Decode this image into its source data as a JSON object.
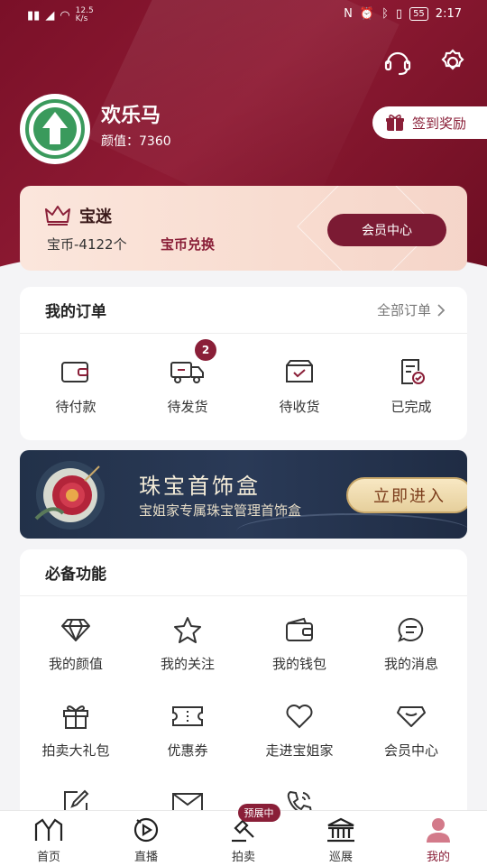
{
  "status_bar": {
    "net_speed": "12.5\nK/s",
    "battery": "55",
    "time": "2:17"
  },
  "profile": {
    "name": "欢乐马",
    "score_label": "颜值：",
    "score_value": "7360"
  },
  "checkin": {
    "label": "签到奖励"
  },
  "member": {
    "level": "宝迷",
    "coins_text": "宝币-4122个",
    "exchange_label": "宝币兑换",
    "center_button": "会员中心"
  },
  "orders": {
    "title": "我的订单",
    "all_label": "全部订单",
    "items": [
      {
        "label": "待付款",
        "icon": "wallet-icon"
      },
      {
        "label": "待发货",
        "icon": "truck-icon",
        "badge": "2"
      },
      {
        "label": "待收货",
        "icon": "box-icon"
      },
      {
        "label": "已完成",
        "icon": "document-check-icon"
      }
    ]
  },
  "banner": {
    "title": "珠宝首饰盒",
    "subtitle": "宝姐家专属珠宝管理首饰盒",
    "button": "立即进入"
  },
  "features": {
    "title": "必备功能",
    "items": [
      {
        "label": "我的颜值",
        "icon": "diamond-icon"
      },
      {
        "label": "我的关注",
        "icon": "star-icon"
      },
      {
        "label": "我的钱包",
        "icon": "wallet-icon"
      },
      {
        "label": "我的消息",
        "icon": "chat-icon"
      },
      {
        "label": "拍卖大礼包",
        "icon": "gift-icon"
      },
      {
        "label": "优惠券",
        "icon": "ticket-icon"
      },
      {
        "label": "走进宝姐家",
        "icon": "heart-icon"
      },
      {
        "label": "会员中心",
        "icon": "gem-icon"
      },
      {
        "label": "",
        "icon": "edit-icon"
      },
      {
        "label": "",
        "icon": "mail-icon"
      },
      {
        "label": "",
        "icon": "phone-icon"
      }
    ]
  },
  "tabbar": {
    "items": [
      {
        "label": "首页",
        "icon": "home-logo-icon"
      },
      {
        "label": "直播",
        "icon": "live-icon"
      },
      {
        "label": "拍卖",
        "icon": "auction-icon",
        "pill": "预展中"
      },
      {
        "label": "巡展",
        "icon": "museum-icon"
      },
      {
        "label": "我的",
        "icon": "user-icon",
        "active": true
      }
    ]
  },
  "colors": {
    "brand": "#8a1f38",
    "hero_bg": "#7a1028",
    "card_bg": "#ffffff"
  }
}
